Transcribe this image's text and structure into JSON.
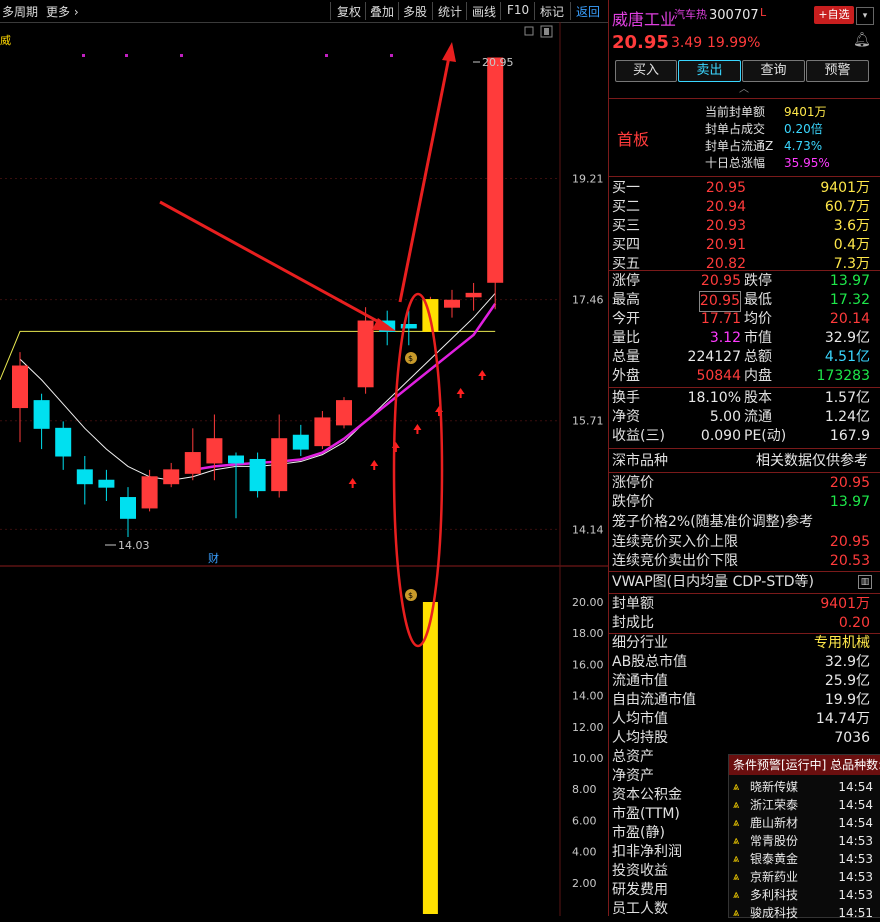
{
  "toolbar": {
    "period": "多周期",
    "more": "更多",
    "more_icon": "chevron-right-icon",
    "buttons": [
      "复权",
      "叠加",
      "多股",
      "统计",
      "画线",
      "F10",
      "标记"
    ],
    "back": "返回",
    "left_mark": "威"
  },
  "chart_data": [
    {
      "type": "candlestick",
      "price_axis_ticks": [
        "19.21",
        "17.46",
        "15.71",
        "14.14"
      ],
      "callouts": {
        "high": "20.95",
        "low": "14.03"
      },
      "event_marker": "财",
      "candles": [
        {
          "o": 15.9,
          "c": 16.5,
          "h": 16.7,
          "l": 15.4
        },
        {
          "o": 16.0,
          "c": 15.6,
          "h": 16.1,
          "l": 15.3
        },
        {
          "o": 15.6,
          "c": 15.2,
          "h": 15.7,
          "l": 15.0
        },
        {
          "o": 15.0,
          "c": 14.8,
          "h": 15.2,
          "l": 14.5
        },
        {
          "o": 14.85,
          "c": 14.75,
          "h": 15.0,
          "l": 14.55
        },
        {
          "o": 14.6,
          "c": 14.3,
          "h": 14.75,
          "l": 14.03
        },
        {
          "o": 14.45,
          "c": 14.9,
          "h": 15.0,
          "l": 14.4
        },
        {
          "o": 14.8,
          "c": 15.0,
          "h": 15.1,
          "l": 14.75
        },
        {
          "o": 14.95,
          "c": 15.25,
          "h": 15.6,
          "l": 14.85
        },
        {
          "o": 15.1,
          "c": 15.45,
          "h": 15.8,
          "l": 14.85
        },
        {
          "o": 15.2,
          "c": 15.1,
          "h": 15.25,
          "l": 14.3
        },
        {
          "o": 15.15,
          "c": 14.7,
          "h": 15.25,
          "l": 14.6
        },
        {
          "o": 14.7,
          "c": 15.45,
          "h": 15.8,
          "l": 14.6
        },
        {
          "o": 15.5,
          "c": 15.3,
          "h": 15.65,
          "l": 15.2
        },
        {
          "o": 15.35,
          "c": 15.75,
          "h": 15.85,
          "l": 15.3
        },
        {
          "o": 15.65,
          "c": 16.0,
          "h": 16.05,
          "l": 15.6
        },
        {
          "o": 16.2,
          "c": 17.15,
          "h": 17.35,
          "l": 16.1
        },
        {
          "o": 17.15,
          "c": 17.0,
          "h": 17.3,
          "l": 16.8
        },
        {
          "o": 17.1,
          "c": 17.05,
          "h": 17.3,
          "l": 16.8
        },
        {
          "o": 17.0,
          "c": 17.46,
          "h": 17.5,
          "l": 17.0
        },
        {
          "o": 17.35,
          "c": 17.45,
          "h": 17.6,
          "l": 17.2
        },
        {
          "o": 17.5,
          "c": 17.55,
          "h": 17.7,
          "l": 17.3
        },
        {
          "o": 17.71,
          "c": 20.95,
          "h": 20.95,
          "l": 17.32
        }
      ],
      "ma_white": [
        16.6,
        16.3,
        15.95,
        15.6,
        15.3,
        15.05,
        14.9,
        14.85,
        14.9,
        15.0,
        15.05,
        15.05,
        15.08,
        15.12,
        15.22,
        15.4,
        15.7,
        16.0,
        16.3,
        16.6,
        16.9,
        17.2,
        17.55
      ],
      "ma_magenta_start_index": 8,
      "ma_magenta": [
        15.0,
        15.05,
        15.08,
        15.1,
        15.12,
        15.15,
        15.25,
        15.45,
        15.7,
        15.95,
        16.2,
        16.45,
        16.7,
        16.95,
        17.4
      ],
      "ma_yellow": [
        16.6,
        17.0,
        17.0,
        17.0,
        17.0,
        17.0,
        17.0,
        17.0,
        17.0,
        17.0,
        17.0,
        17.0,
        17.0,
        17.0,
        17.0,
        17.0,
        17.0,
        17.0,
        17.0,
        17.0,
        17.0,
        17.0,
        17.0
      ]
    },
    {
      "type": "bar",
      "title": "",
      "yticks": [
        "20.00",
        "18.00",
        "16.00",
        "14.00",
        "12.00",
        "10.00",
        "8.00",
        "6.00",
        "4.00",
        "2.00"
      ],
      "values": [
        20.0
      ]
    }
  ],
  "quote": {
    "name": "威唐工业",
    "tag": "汽车热",
    "code": "300707",
    "code_mark": "L",
    "add_fav": "+自选",
    "price": "20.95",
    "change": "3.49",
    "pct": "19.99%",
    "bell_icon": "bell-icon",
    "buttons": [
      "买入",
      "卖出",
      "查询",
      "预警"
    ],
    "collapse_icon": "chevron-up-icon"
  },
  "limit_up": {
    "label": "首板",
    "rows": [
      {
        "k": "当前封单额",
        "v": "9401万"
      },
      {
        "k": "封单占成交",
        "v": "0.20倍"
      },
      {
        "k": "封单占流通Z",
        "v": "4.73%"
      },
      {
        "k": "十日总涨幅",
        "v": "35.95%"
      }
    ]
  },
  "bids": [
    {
      "k": "买一",
      "p": "20.95",
      "v": "9401万"
    },
    {
      "k": "买二",
      "p": "20.94",
      "v": "60.7万"
    },
    {
      "k": "买三",
      "p": "20.93",
      "v": "3.6万"
    },
    {
      "k": "买四",
      "p": "20.91",
      "v": "0.4万"
    },
    {
      "k": "买五",
      "p": "20.82",
      "v": "7.3万"
    }
  ],
  "stats": [
    {
      "k1": "涨停",
      "v1": "20.95",
      "k2": "跌停",
      "v2": "13.97"
    },
    {
      "k1": "最高",
      "v1": "20.95",
      "k2": "最低",
      "v2": "17.32"
    },
    {
      "k1": "今开",
      "v1": "17.71",
      "k2": "均价",
      "v2": "20.14"
    },
    {
      "k1": "量比",
      "v1": "3.12",
      "k2": "市值",
      "v2": "32.9亿"
    },
    {
      "k1": "总量",
      "v1": "224127",
      "k2": "总额",
      "v2": "4.51亿"
    },
    {
      "k1": "外盘",
      "v1": "50844",
      "k2": "内盘",
      "v2": "173283"
    }
  ],
  "stats2": [
    {
      "k1": "换手",
      "v1": "18.10%",
      "k2": "股本",
      "v2": "1.57亿"
    },
    {
      "k1": "净资",
      "v1": "5.00",
      "k2": "流通",
      "v2": "1.24亿"
    },
    {
      "k1": "收益(三)",
      "v1": "0.090",
      "k2": "PE(动)",
      "v2": "167.9"
    }
  ],
  "market": {
    "title": "深市品种",
    "note": "相关数据仅供参考",
    "rows": [
      {
        "k": "涨停价",
        "v": "20.95"
      },
      {
        "k": "跌停价",
        "v": "13.97"
      }
    ],
    "cage": "笼子价格2%(随基准价调整)参考",
    "rows2": [
      {
        "k": "连续竞价买入价上限",
        "v": "20.95"
      },
      {
        "k": "连续竞价卖出价下限",
        "v": "20.53"
      }
    ]
  },
  "vwap": {
    "title": "VWAP图(日内均量 CDP-STD等)",
    "rows": [
      {
        "k": "封单额",
        "v": "9401万"
      },
      {
        "k": "封成比",
        "v": "0.20"
      }
    ]
  },
  "fund": {
    "rows": [
      {
        "k": "细分行业",
        "v": "专用机械"
      },
      {
        "k": "AB股总市值",
        "v": "32.9亿"
      },
      {
        "k": "流通市值",
        "v": "25.9亿"
      },
      {
        "k": "自由流通市值",
        "v": "19.9亿"
      },
      {
        "k": "人均市值",
        "v": "14.74万"
      },
      {
        "k": "人均持股",
        "v": "7036"
      },
      {
        "k": "总资产",
        "v": ""
      },
      {
        "k": "净资产",
        "v": ""
      },
      {
        "k": "资本公积金",
        "v": ""
      },
      {
        "k": "市盈(TTM)",
        "v": ""
      },
      {
        "k": "市盈(静)",
        "v": ""
      },
      {
        "k": "扣非净利润",
        "v": ""
      },
      {
        "k": "投资收益",
        "v": ""
      },
      {
        "k": "研发费用",
        "v": ""
      },
      {
        "k": "员工人数",
        "v": ""
      }
    ]
  },
  "alerts": {
    "title": "条件预警[运行中] 总品种数:",
    "items": [
      {
        "name": "晓新传媒",
        "time": "14:54"
      },
      {
        "name": "浙江荣泰",
        "time": "14:54"
      },
      {
        "name": "鹿山新材",
        "time": "14:54"
      },
      {
        "name": "常青股份",
        "time": "14:53"
      },
      {
        "name": "银泰黄金",
        "time": "14:53"
      },
      {
        "name": "京新药业",
        "time": "14:53"
      },
      {
        "name": "多利科技",
        "time": "14:53"
      },
      {
        "name": "骏成科技",
        "time": "14:51"
      }
    ]
  },
  "colors": {
    "up": "#ff3b3b",
    "down": "#00e0f0",
    "ma_magenta": "#e020e0",
    "vol": "#ffe000"
  }
}
